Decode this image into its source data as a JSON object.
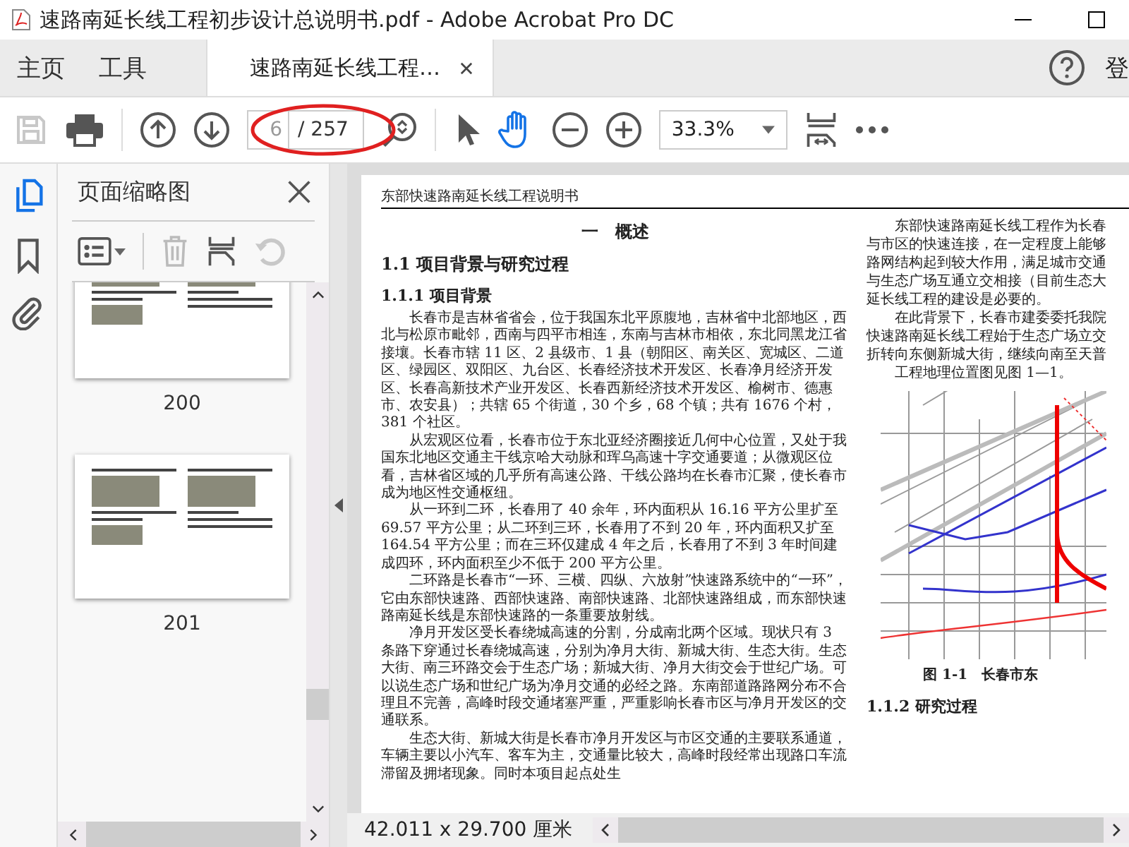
{
  "window": {
    "title": "速路南延长线工程初步设计总说明书.pdf - Adobe Acrobat Pro DC"
  },
  "tabs": [
    {
      "label": "主页",
      "selected": false
    },
    {
      "label": "工具",
      "selected": false
    },
    {
      "label": "速路南延长线工程…",
      "selected": true
    }
  ],
  "account_label": "登",
  "toolbar": {
    "page_number": "6",
    "page_total": "/ 257",
    "zoom": "33.3%",
    "tools": [
      {
        "kind": "select",
        "selected": false
      },
      {
        "kind": "hand",
        "selected": true
      }
    ]
  },
  "sidebar": {
    "rail": [
      {
        "kind": "pages",
        "selected": true
      },
      {
        "kind": "bookmarks",
        "selected": false
      },
      {
        "kind": "attachments",
        "selected": false
      }
    ],
    "title": "页面缩略图",
    "thumbnails": [
      {
        "page": "200"
      },
      {
        "page": "201"
      }
    ]
  },
  "document": {
    "running_header": "东部快速路南延长线工程说明书",
    "chapter_title": "一　概述",
    "section_title": "1.1 项目背景与研究过程",
    "subsection_title": "1.1.1 项目背景",
    "paragraphs": [
      "长春市是吉林省省会，位于我国东北平原腹地，吉林省中北部地区，西北与松原市毗邻，西南与四平市相连，东南与吉林市相依，东北同黑龙江省接壤。长春市辖 11 区、2 县级市、1 县（朝阳区、南关区、宽城区、二道区、绿园区、双阳区、九台区、长春经济技术开发区、长春净月经济开发区、长春高新技术产业开发区、长春西新经济技术开发区、榆树市、德惠市、农安县）；共辖 65 个街道，30 个乡，68 个镇；共有 1676 个村，381 个社区。",
      "从宏观区位看，长春市位于东北亚经济圈接近几何中心位置，又处于我国东北地区交通主干线京哈大动脉和珲乌高速十字交通要道；从微观区位看，吉林省区域的几乎所有高速公路、干线公路均在长春市汇聚，使长春市成为地区性交通枢纽。",
      "从一环到二环，长春用了 40 余年，环内面积从 16.16 平方公里扩至 69.57 平方公里；从二环到三环，长春用了不到 20 年，环内面积又扩至 164.54 平方公里；而在三环仅建成 4 年之后，长春用了不到 3 年时间建成四环，环内面积至少不低于 200 平方公里。",
      "二环路是长春市“一环、三横、四纵、六放射”快速路系统中的“一环”，它由东部快速路、西部快速路、南部快速路、北部快速路组成，而东部快速路南延长线是东部快速路的一条重要放射线。",
      "净月开发区受长春绕城高速的分割，分成南北两个区域。现状只有 3 条路下穿通过长春绕城高速，分别为净月大街、新城大街、生态大街。生态大街、南三环路交会于生态广场；新城大街、净月大街交会于世纪广场。可以说生态广场和世纪广场为净月交通的必经之路。东南部道路路网分布不合理且不完善，高峰时段交通堵塞严重，严重影响长春市区与净月开发区的交通联系。",
      "生态大街、新城大街是长春市净月开发区与市区交通的主要联系通道，车辆主要以小汽车、客车为主，交通量比较大，高峰时段经常出现路口车流滞留及拥堵现象。同时本项目起点处生"
    ],
    "right_lines": [
      {
        "text": "东部快速路南延长线工程作为长春",
        "indent": true
      },
      {
        "text": "与市区的快速连接，在一定程度上能够",
        "indent": false
      },
      {
        "text": "路网结构起到较大作用，满足城市交通",
        "indent": false
      },
      {
        "text": "与生态广场互通立交相接（目前生态大",
        "indent": false
      },
      {
        "text": "延长线工程的建设是必要的。",
        "indent": false
      },
      {
        "text": "在此背景下，长春市建委委托我院",
        "indent": true
      },
      {
        "text": "快速路南延长线工程始于生态广场立交",
        "indent": false
      },
      {
        "text": "折转向东侧新城大街，继续向南至天普",
        "indent": false
      },
      {
        "text": "工程地理位置图见图 1—1。",
        "indent": true
      }
    ],
    "figure_caption": "图 1-1　长春市东",
    "next_heading": "1.1.2 研究过程"
  },
  "status_bar": {
    "page_size": "42.011 x 29.700 厘米"
  }
}
